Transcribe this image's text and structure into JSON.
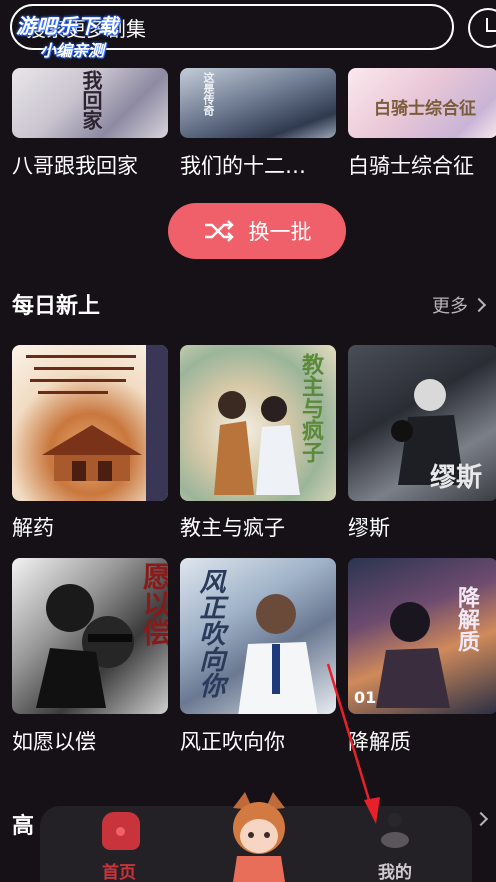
{
  "search": {
    "text": "搜索更多剧集"
  },
  "watermark": {
    "line1": "游吧乐下载",
    "line2": "小编亲测"
  },
  "top_row": [
    {
      "title": "八哥跟我回家",
      "cover_text": "我回家"
    },
    {
      "title": "我们的十二…",
      "cover_text": "这是传奇"
    },
    {
      "title": "白骑士综合征",
      "cover_text": "白骑士综合征"
    }
  ],
  "shuffle": {
    "label": "换一批"
  },
  "section": {
    "title": "每日新上",
    "more": "更多"
  },
  "grid": [
    {
      "title": "解药"
    },
    {
      "title": "教主与疯子",
      "cover_text": "教主与疯子"
    },
    {
      "title": "缪斯",
      "cover_text": "缪斯"
    },
    {
      "title": "如愿以偿",
      "cover_text": "愿以偿"
    },
    {
      "title": "风正吹向你",
      "cover_text": "风正吹向你"
    },
    {
      "title": "降解质",
      "cover_text": "降解质",
      "badge": "01"
    }
  ],
  "next_section": {
    "title": "高"
  },
  "nav": {
    "home": "首页",
    "me": "我的"
  },
  "colors": {
    "accent": "#f0606a",
    "home_active": "#c9343c",
    "background": "#151117",
    "annotation": "#e8202a"
  }
}
